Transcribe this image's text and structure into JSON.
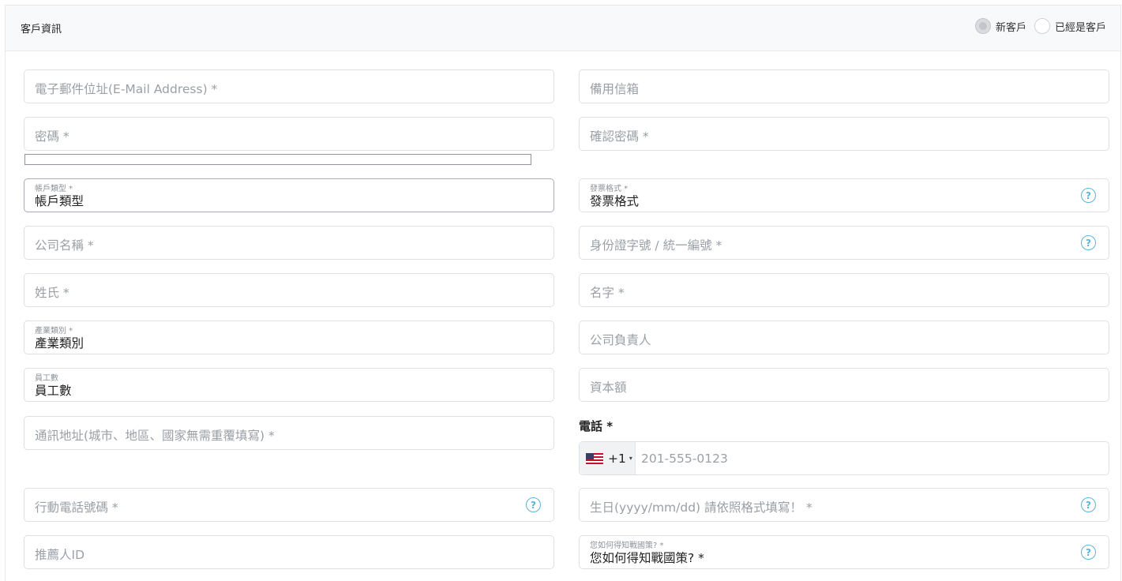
{
  "header": {
    "title": "客戶資訊",
    "customer_type": {
      "options": [
        {
          "label": "新客戶",
          "checked": true
        },
        {
          "label": "已經是客戶",
          "checked": false
        }
      ]
    }
  },
  "fields": {
    "email": {
      "placeholder": "電子郵件位址(E-Mail Address) *"
    },
    "backup_email": {
      "placeholder": "備用信箱"
    },
    "password": {
      "placeholder": "密碼 *"
    },
    "confirm_password": {
      "placeholder": "確認密碼 *"
    },
    "account_type": {
      "label": "帳戶類型 *",
      "value": "帳戶類型"
    },
    "invoice_format": {
      "label": "發票格式 *",
      "value": "發票格式"
    },
    "company_name": {
      "placeholder": "公司名稱 *"
    },
    "tax_id": {
      "placeholder": "身份證字號 / 統一編號 *"
    },
    "last_name": {
      "placeholder": "姓氏 *"
    },
    "first_name": {
      "placeholder": "名字 *"
    },
    "industry": {
      "label": "產業類別 *",
      "value": "產業類別"
    },
    "company_owner": {
      "placeholder": "公司負責人"
    },
    "employees": {
      "label": "員工數",
      "value": "員工數"
    },
    "capital": {
      "placeholder": "資本額"
    },
    "address": {
      "placeholder": "通訊地址(城市、地區、國家無需重覆填寫) *"
    },
    "phone": {
      "label": "電話 *",
      "country_code": "+1",
      "placeholder": "201-555-0123",
      "flag": "us-flag-icon"
    },
    "mobile": {
      "placeholder": "行動電話號碼 *"
    },
    "birthday": {
      "placeholder": "生日(yyyy/mm/dd) 請依照格式填寫！ *"
    },
    "referrer": {
      "placeholder": "推薦人ID"
    },
    "source": {
      "label": "您如何得知戰國策? *",
      "value": "您如何得知戰國策? *"
    }
  },
  "icons": {
    "help": "?",
    "caret": "▾"
  },
  "colors": {
    "help_icon": "#5fb2d8",
    "border": "#dde1e6",
    "placeholder": "#9aa0a6",
    "header_bg": "#f8f9fb"
  }
}
